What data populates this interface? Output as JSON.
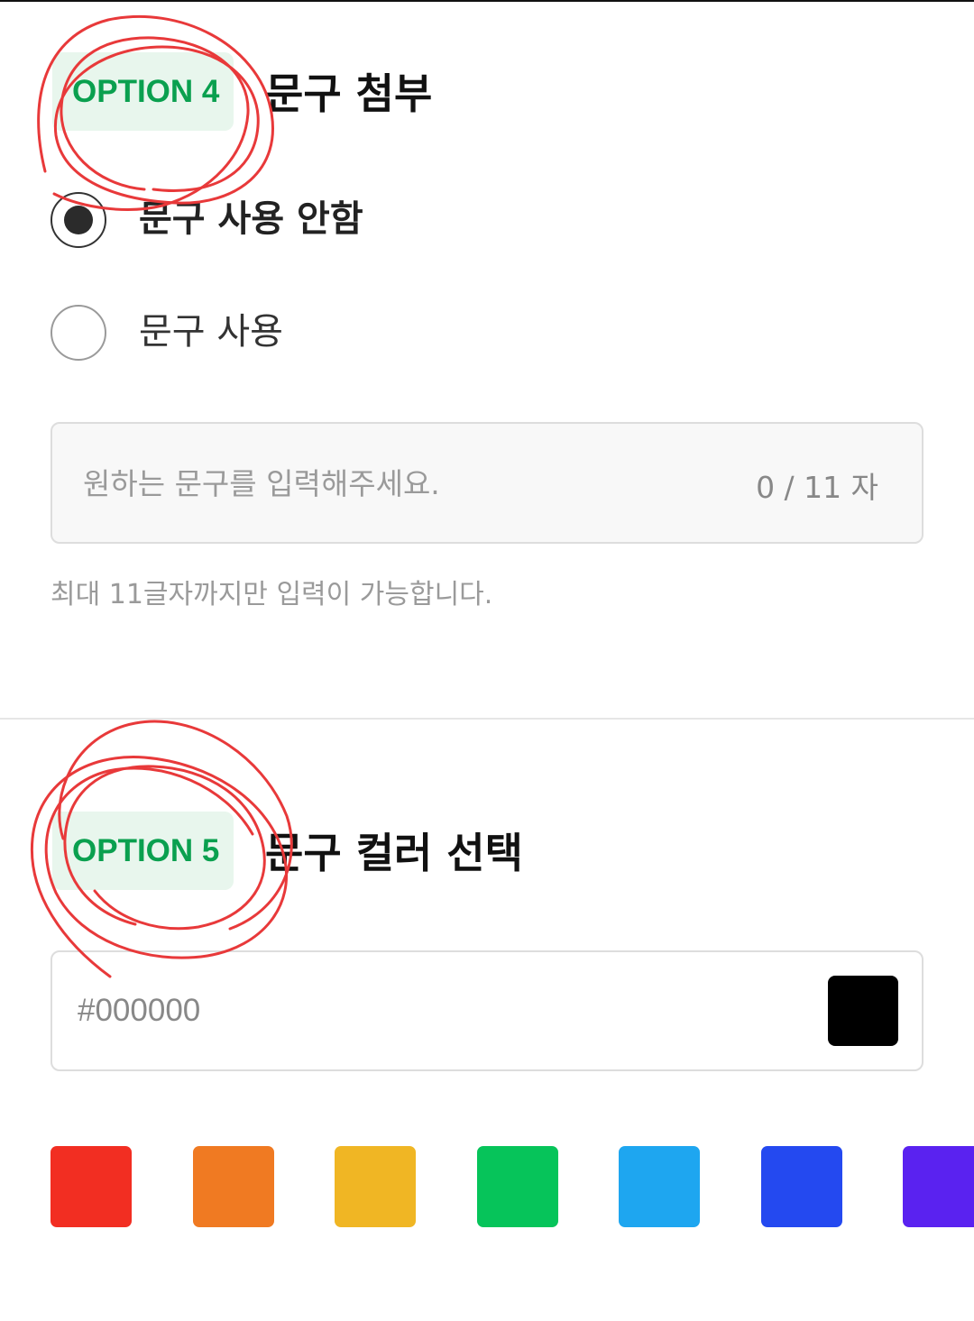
{
  "option4": {
    "badge": "OPTION 4",
    "title": "문구 첨부",
    "radios": [
      {
        "label": "문구 사용 안함",
        "checked": true
      },
      {
        "label": "문구 사용",
        "checked": false
      }
    ],
    "input": {
      "placeholder": "원하는 문구를 입력해주세요.",
      "value": "",
      "counter": "0 / 11 자"
    },
    "helper": "최대 11글자까지만 입력이 가능합니다."
  },
  "option5": {
    "badge": "OPTION 5",
    "title": "문구 컬러 선택",
    "color_input": {
      "value": "#000000",
      "preview_color": "#000000"
    },
    "swatches": [
      "#f22e22",
      "#f07a22",
      "#f0b624",
      "#06c45a",
      "#1ea6f0",
      "#2449f0",
      "#5a22f0"
    ]
  },
  "colors": {
    "accent_green": "#0aa04f",
    "badge_bg": "#e8f6ed",
    "annotation_red": "#e8393a"
  }
}
